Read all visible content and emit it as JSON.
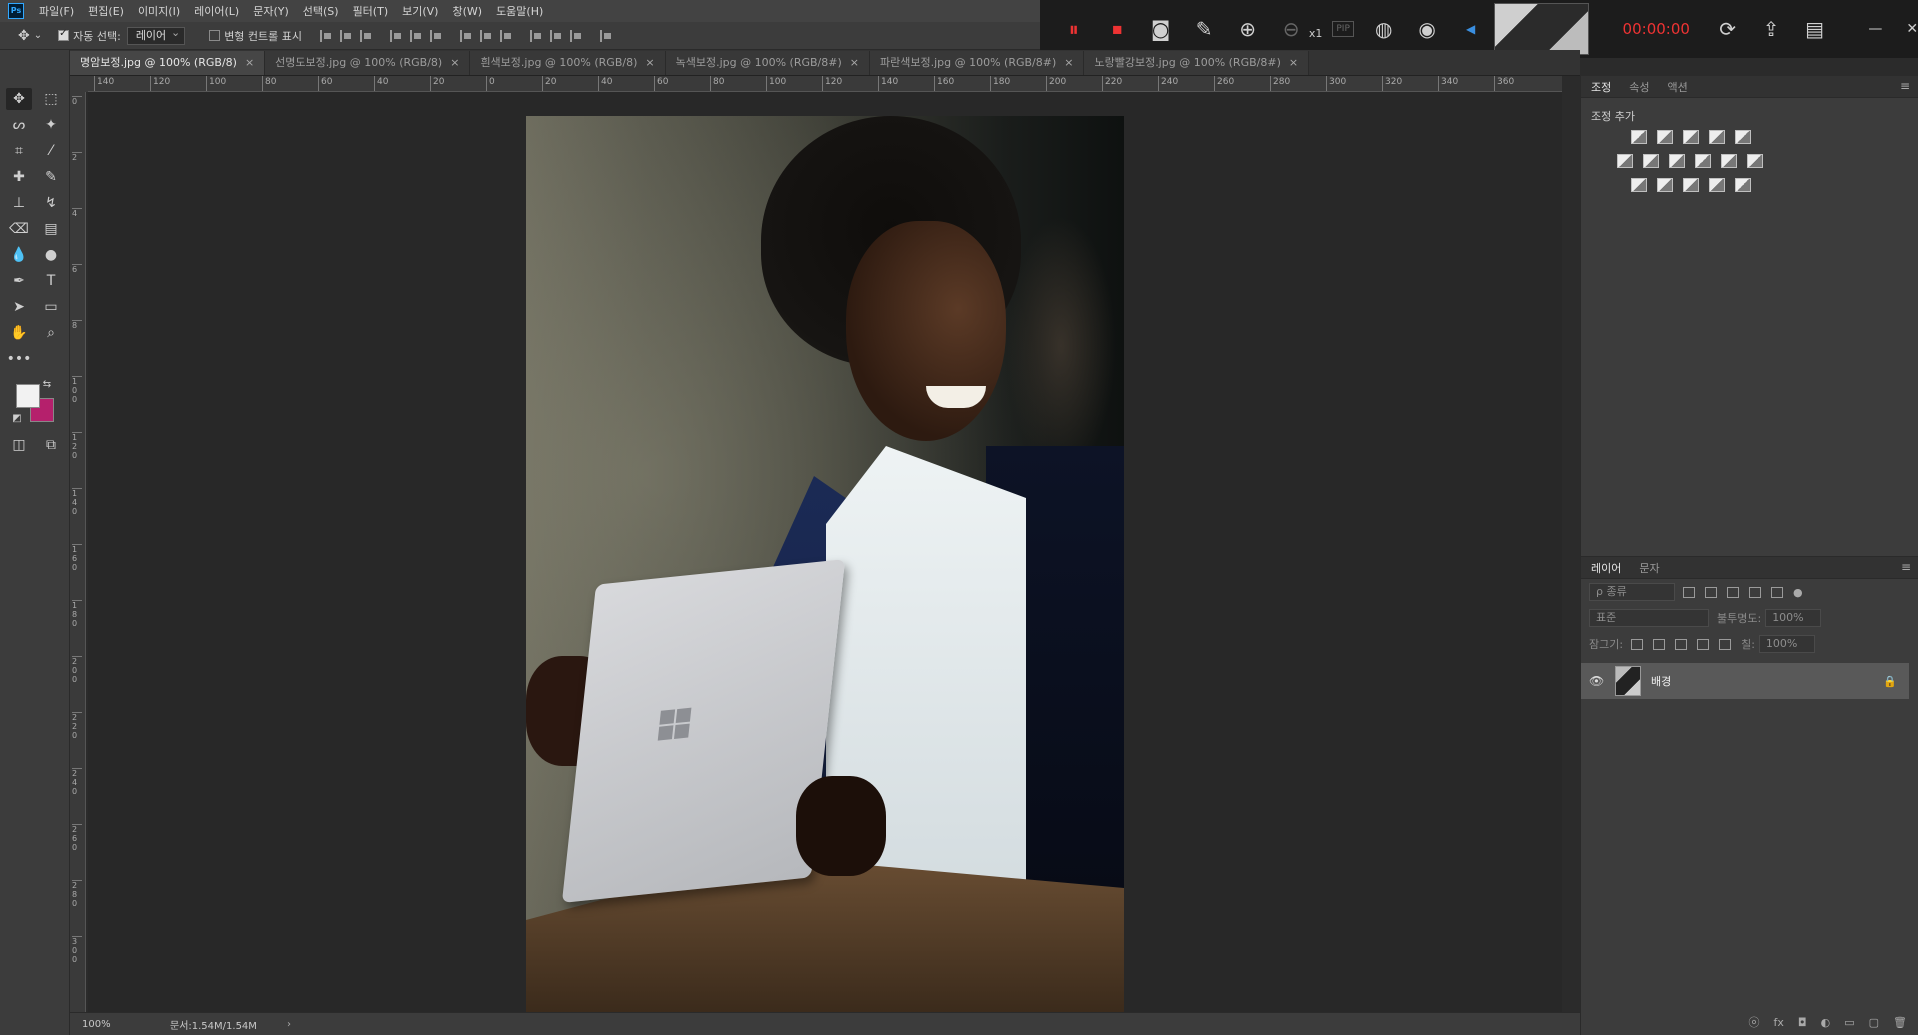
{
  "app": {
    "logo": "Ps"
  },
  "menu": [
    "파일(F)",
    "편집(E)",
    "이미지(I)",
    "레이어(L)",
    "문자(Y)",
    "선택(S)",
    "필터(T)",
    "보기(V)",
    "창(W)",
    "도움말(H)"
  ],
  "options": {
    "move_icon": "move-icon",
    "auto_select_label": "자동 선택:",
    "auto_select_value": "레이어",
    "transform_label": "변형 컨트롤 표시"
  },
  "recorder": {
    "time": "00:00:00",
    "zoom_factor": "x1",
    "pip_label": "PIP"
  },
  "tabs": [
    {
      "label": "명암보정.jpg @ 100% (RGB/8)",
      "active": true
    },
    {
      "label": "선명도보정.jpg @ 100% (RGB/8)"
    },
    {
      "label": "흰색보정.jpg @ 100% (RGB/8)"
    },
    {
      "label": "녹색보정.jpg @ 100% (RGB/8#)"
    },
    {
      "label": "파란색보정.jpg @ 100% (RGB/8#)"
    },
    {
      "label": "노랑빨강보정.jpg @ 100% (RGB/8#)"
    }
  ],
  "tab_close": "×",
  "ruler_h": [
    "140",
    "120",
    "100",
    "80",
    "60",
    "40",
    "20",
    "0",
    "20",
    "40",
    "60",
    "80",
    "100",
    "120",
    "140",
    "160",
    "180",
    "200",
    "220",
    "240",
    "260",
    "280",
    "300",
    "320",
    "340",
    "360"
  ],
  "ruler_v": [
    "0",
    "2",
    "4",
    "6",
    "8",
    "100",
    "120",
    "140",
    "160",
    "180",
    "200",
    "220",
    "240",
    "260",
    "280",
    "300"
  ],
  "status": {
    "zoom": "100%",
    "doc": "문서:1.54M/1.54M",
    "arrow": "›"
  },
  "right_panel": {
    "tabs": [
      "조정",
      "속성",
      "액션"
    ],
    "adjust_title": "조정 추가",
    "menu_icon": "≡"
  },
  "layers_panel": {
    "tabs": [
      "레이어",
      "문자"
    ],
    "filter_label": "ρ 종류",
    "blend_mode": "표준",
    "opacity_label": "불투명도:",
    "opacity_value": "100%",
    "lock_label": "잠그기:",
    "fill_label": "칠:",
    "fill_value": "100%",
    "layer_name": "배경",
    "bottom_icons": [
      "ⓞ",
      "fx",
      "◘",
      "◐",
      "▭",
      "▢",
      "🗑"
    ]
  },
  "colors": {
    "foreground": "#f2f2f2",
    "background": "#b5206c",
    "recorder_red": "#e33333"
  }
}
